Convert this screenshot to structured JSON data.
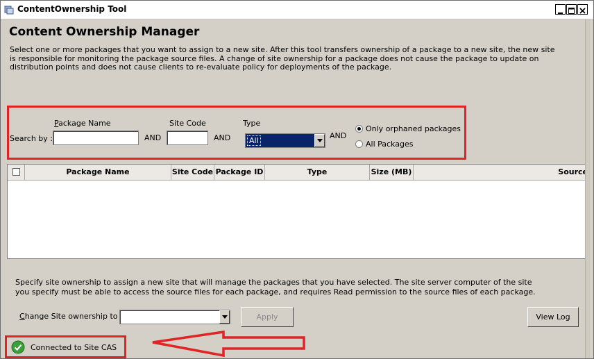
{
  "window": {
    "title": "ContentOwnership Tool",
    "controls": [
      "minimize",
      "maximize",
      "close"
    ]
  },
  "header": {
    "title": "Content Ownership Manager",
    "description": "Select one or more packages that you want to assign to a new site. After this tool transfers ownership of a package to a new site, the new site is responsible for monitoring the package source files. A change of site ownership for a package does not cause the package to update on distribution points and does not cause clients to re-evaluate policy for deployments of the package."
  },
  "search": {
    "search_by_label": "Search by :",
    "package_name_label": "Package Name",
    "package_name_value": "",
    "and1": "AND",
    "site_code_label": "Site Code",
    "site_code_value": "",
    "and2": "AND",
    "type_label": "Type",
    "type_value": "All",
    "and3": "AND",
    "radio_orphaned": "Only orphaned packages",
    "radio_all": "All Packages",
    "selected_radio": "orphaned"
  },
  "grid": {
    "columns": [
      "Package Name",
      "Site Code",
      "Package ID",
      "Type",
      "Size (MB)",
      "Source"
    ],
    "rows": []
  },
  "ownership": {
    "description": "Specify site ownership to assign a new site that will manage the packages that you have selected. The site server computer of the site you specify must be able to access the source files for each package, and requires Read permission to the source files of each package.",
    "change_label": "Change Site ownership to",
    "change_value": "",
    "apply_label": "Apply",
    "view_log_label": "View Log"
  },
  "status": {
    "text": "Connected to Site CAS"
  },
  "colors": {
    "highlight_red": "#e02424",
    "selection_blue": "#0a246a",
    "status_green": "#3aa13a"
  }
}
